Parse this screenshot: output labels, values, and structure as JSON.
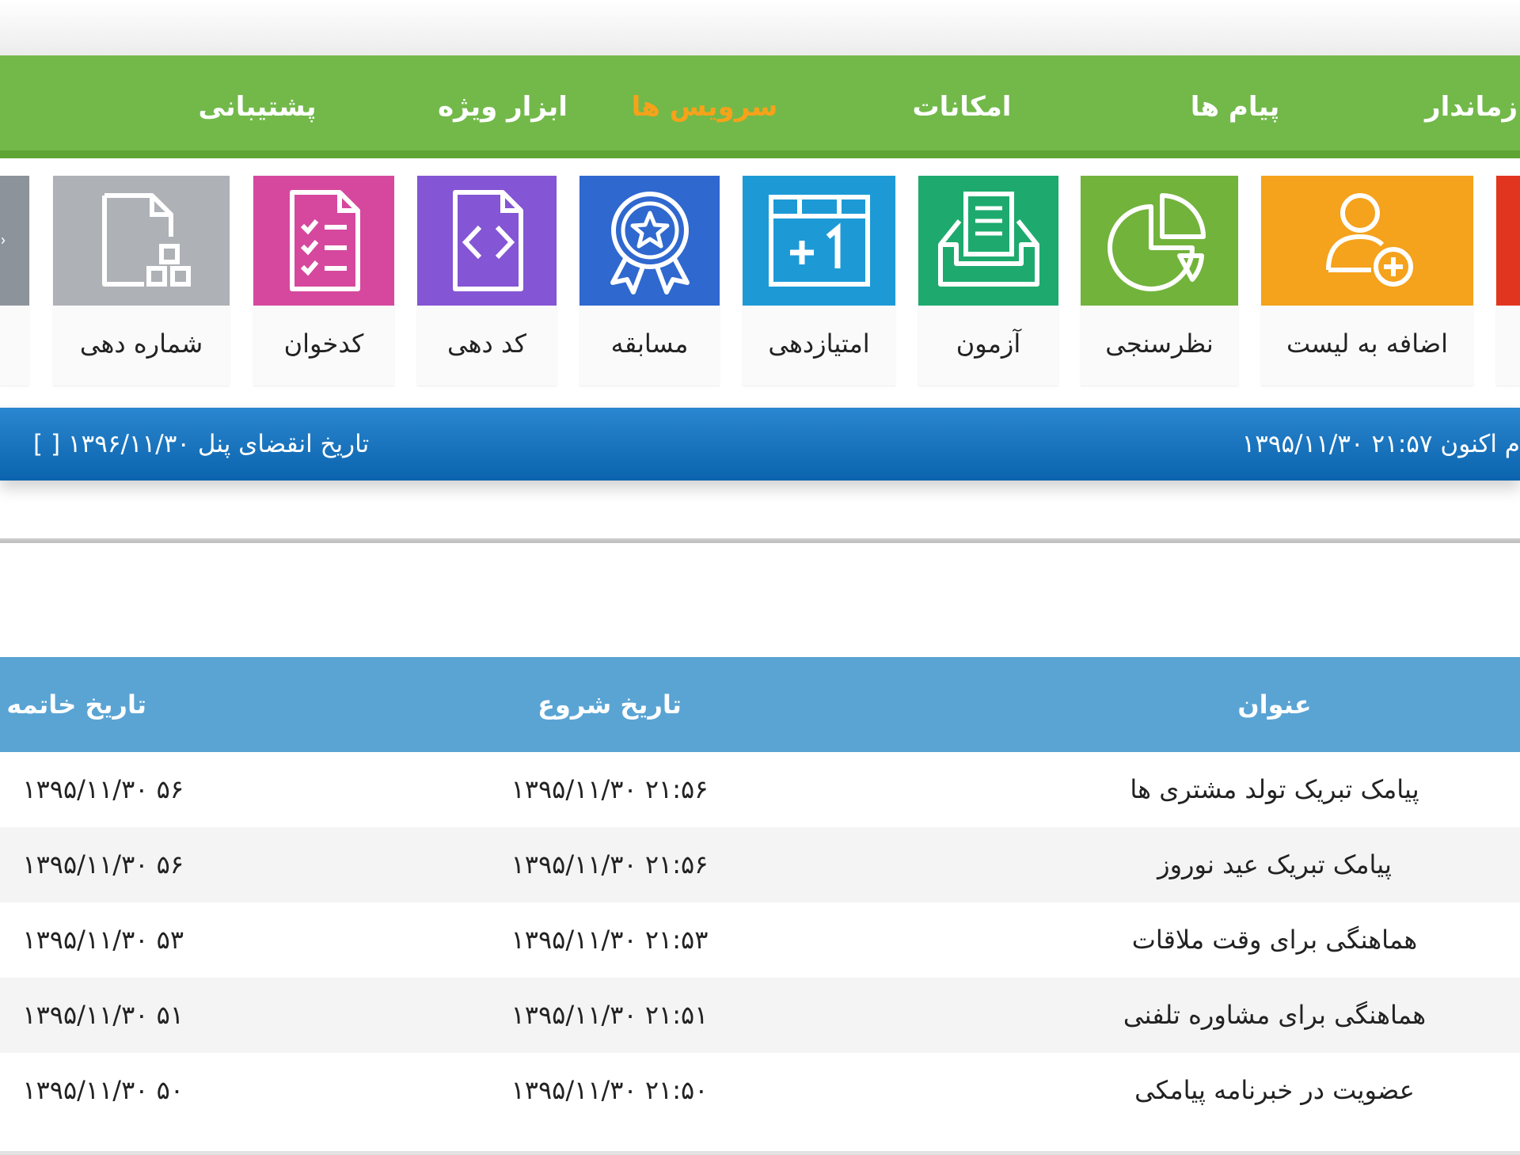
{
  "nav": {
    "items": [
      {
        "label": "پشتیبانی",
        "active": false
      },
      {
        "label": "ابزار ویژه",
        "active": false
      },
      {
        "label": "سرویس ها",
        "active": true
      },
      {
        "label": "امکانات",
        "active": false
      },
      {
        "label": "پیام ها",
        "active": false
      },
      {
        "label": "زماندار",
        "active": false
      }
    ]
  },
  "services": {
    "tiles": [
      {
        "label": "",
        "color": "#8d939b",
        "icon": "arrow-icon"
      },
      {
        "label": "شماره دهی",
        "color": "#aeb1b5",
        "icon": "document-numbering-icon"
      },
      {
        "label": "کدخوان",
        "color": "#d6489e",
        "icon": "checklist-document-icon"
      },
      {
        "label": "کد دهی",
        "color": "#8455d4",
        "icon": "code-document-icon"
      },
      {
        "label": "مسابقه",
        "color": "#2f68cf",
        "icon": "award-star-icon"
      },
      {
        "label": "امتیازدهی",
        "color": "#1d9ad6",
        "icon": "calendar-plus-one-icon"
      },
      {
        "label": "آزمون",
        "color": "#1eaa6e",
        "icon": "inbox-document-icon"
      },
      {
        "label": "نظرسنجی",
        "color": "#72b33c",
        "icon": "pie-chart-icon"
      },
      {
        "label": "اضافه به لیست",
        "color": "#f5a21c",
        "icon": "add-user-icon"
      },
      {
        "label": "",
        "color": "#e2351f",
        "icon": "partial-tile"
      }
    ]
  },
  "status_bar": {
    "expiry_label": "تاریخ انقضای پنل",
    "expiry_value": "۱۳۹۶/۱۱/۳۰ [ ]",
    "now_label": "اکنون",
    "now_value": "۲۱:۵۷ ۱۳۹۵/۱۱/۳۰",
    "now_prefix_partial": "م"
  },
  "table": {
    "headers": {
      "title": "عنوان",
      "start": "تاریخ شروع",
      "end": "تاریخ خاتمه"
    },
    "rows": [
      {
        "title": "پیامک تبریک تولد مشتری ها",
        "start": "۲۱:۵۶ ۱۳۹۵/۱۱/۳۰",
        "end": "۱۳۹۵/۱۱/۳۰ ۵۶"
      },
      {
        "title": "پیامک تبریک عید نوروز",
        "start": "۲۱:۵۶ ۱۳۹۵/۱۱/۳۰",
        "end": "۱۳۹۵/۱۱/۳۰ ۵۶"
      },
      {
        "title": "هماهنگی برای وقت ملاقات",
        "start": "۲۱:۵۳ ۱۳۹۵/۱۱/۳۰",
        "end": "۱۳۹۵/۱۱/۳۰ ۵۳"
      },
      {
        "title": "هماهنگی برای مشاوره تلفنی",
        "start": "۲۱:۵۱ ۱۳۹۵/۱۱/۳۰",
        "end": "۱۳۹۵/۱۱/۳۰ ۵۱"
      },
      {
        "title": "عضویت در خبرنامه پیامکی",
        "start": "۲۱:۵۰ ۱۳۹۵/۱۱/۳۰",
        "end": "۱۳۹۵/۱۱/۳۰ ۵۰"
      }
    ]
  }
}
